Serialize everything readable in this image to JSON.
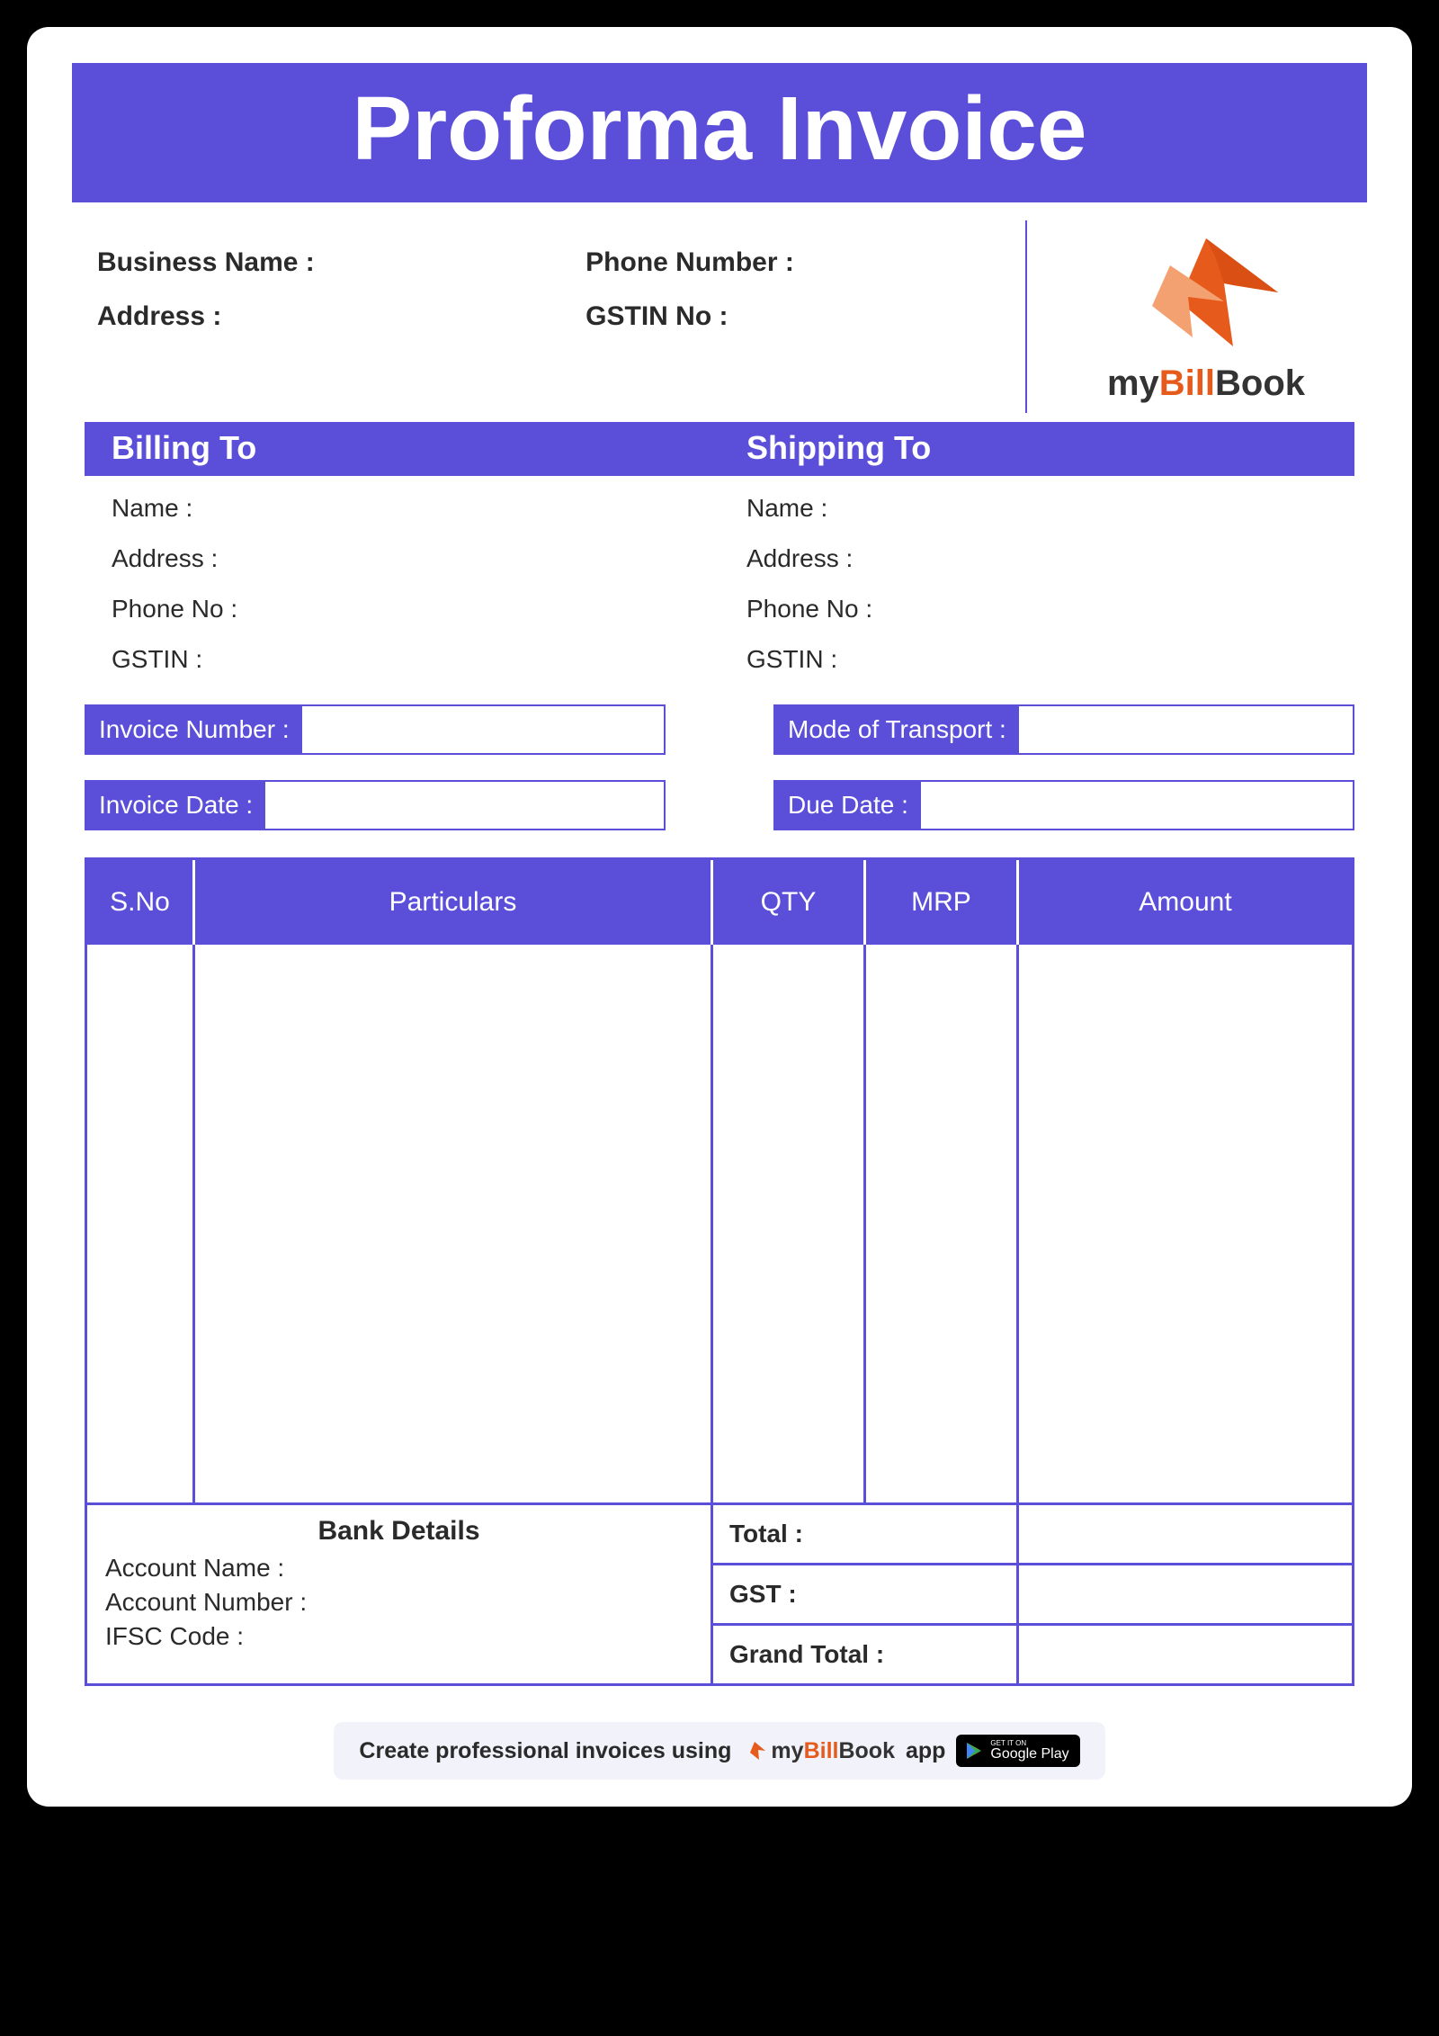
{
  "title": "Proforma Invoice",
  "business": {
    "name_label": "Business Name :",
    "address_label": "Address :",
    "phone_label": "Phone Number :",
    "gstin_label": "GSTIN No :"
  },
  "logo": {
    "my": "my",
    "bill": "Bill",
    "book": "Book"
  },
  "sections": {
    "billing": "Billing To",
    "shipping": "Shipping To"
  },
  "billing": {
    "name": "Name :",
    "address": "Address :",
    "phone": "Phone No :",
    "gstin": "GSTIN :"
  },
  "shipping": {
    "name": "Name :",
    "address": "Address :",
    "phone": "Phone No :",
    "gstin": "GSTIN :"
  },
  "inputs": {
    "invoice_no": "Invoice Number :",
    "transport": "Mode of Transport :",
    "invoice_date": "Invoice Date :",
    "due_date": "Due Date :"
  },
  "table": {
    "sno": "S.No",
    "particulars": "Particulars",
    "qty": "QTY",
    "mrp": "MRP",
    "amount": "Amount"
  },
  "bank": {
    "title": "Bank Details",
    "account_name": "Account Name :",
    "account_number": "Account Number :",
    "ifsc": "IFSC Code :"
  },
  "totals": {
    "total": "Total :",
    "gst": "GST :",
    "grand": "Grand Total :"
  },
  "footer": {
    "pre": "Create professional invoices using",
    "app": "app",
    "gplay_small": "GET IT ON",
    "gplay_big": "Google Play"
  }
}
